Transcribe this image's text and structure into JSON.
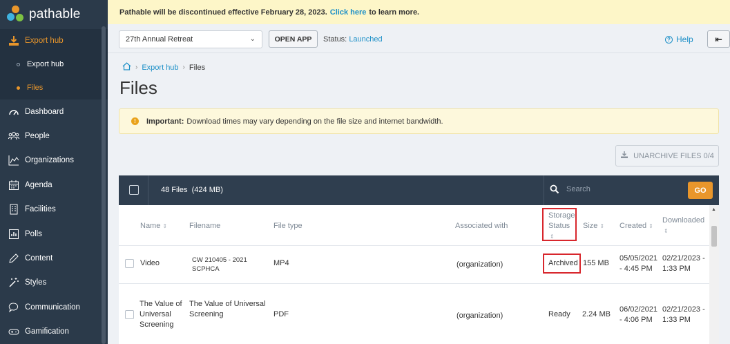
{
  "brand": {
    "name": "pathable",
    "accent": "#e9962b",
    "link": "#1b8fc7",
    "sidebar_bg": "#2b3a4a"
  },
  "banner": {
    "prefix": "Pathable will be discontinued effective February 28, 2023.",
    "link": "Click here",
    "suffix": "to learn more."
  },
  "sidebar": {
    "export_hub": {
      "label": "Export hub",
      "icon": "download-icon"
    },
    "sub_items": [
      {
        "label": "Export hub",
        "active": false
      },
      {
        "label": "Files",
        "active": true
      }
    ],
    "items": [
      {
        "label": "Dashboard",
        "icon": "dashboard-icon"
      },
      {
        "label": "People",
        "icon": "people-icon"
      },
      {
        "label": "Organizations",
        "icon": "organizations-icon"
      },
      {
        "label": "Agenda",
        "icon": "calendar-icon"
      },
      {
        "label": "Facilities",
        "icon": "building-icon"
      },
      {
        "label": "Polls",
        "icon": "polls-icon"
      },
      {
        "label": "Content",
        "icon": "pencil-icon"
      },
      {
        "label": "Styles",
        "icon": "magic-wand-icon"
      },
      {
        "label": "Communication",
        "icon": "chat-icon"
      },
      {
        "label": "Gamification",
        "icon": "gamepad-icon"
      }
    ]
  },
  "toolbar": {
    "event": "27th Annual Retreat",
    "open_app": "OPEN APP",
    "status_label": "Status:",
    "status_value": "Launched",
    "help": "Help"
  },
  "breadcrumb": {
    "home_icon": "home-icon",
    "link": "Export hub",
    "current": "Files"
  },
  "page_title": "Files",
  "alert": {
    "bold": "Important:",
    "text": "Download times may vary depending on the file size and internet bandwidth."
  },
  "unarchive": "UNARCHIVE FILES 0/4",
  "table_bar": {
    "count": "48 Files  (424 MB)",
    "search_placeholder": "Search",
    "go": "GO"
  },
  "columns": {
    "name": "Name",
    "filename": "Filename",
    "file_type": "File type",
    "associated": "Associated with",
    "storage_1": "Storage",
    "storage_2": "Status",
    "size": "Size",
    "created": "Created",
    "downloaded": "Downloaded"
  },
  "rows": [
    {
      "name": "Video",
      "filename_1": "CW 210405 - 2021",
      "filename_2": "SCPHCA",
      "file_type": "MP4",
      "associated": "(organization)",
      "storage": "Archived",
      "size": "155 MB",
      "created_1": "05/05/2021",
      "created_2": "- 4:45 PM",
      "downloaded_1": "02/21/2023 -",
      "downloaded_2": "1:33 PM"
    },
    {
      "name_1": "The Value of",
      "name_2": "Universal",
      "name_3": "Screening",
      "filename_1": "The Value of Universal",
      "filename_2": "Screening",
      "file_type": "PDF",
      "associated": "(organization)",
      "storage": "Ready",
      "size": "2.24 MB",
      "created_1": "06/02/2021",
      "created_2": "- 4:06 PM",
      "downloaded_1": "02/21/2023 -",
      "downloaded_2": "1:33 PM"
    }
  ]
}
